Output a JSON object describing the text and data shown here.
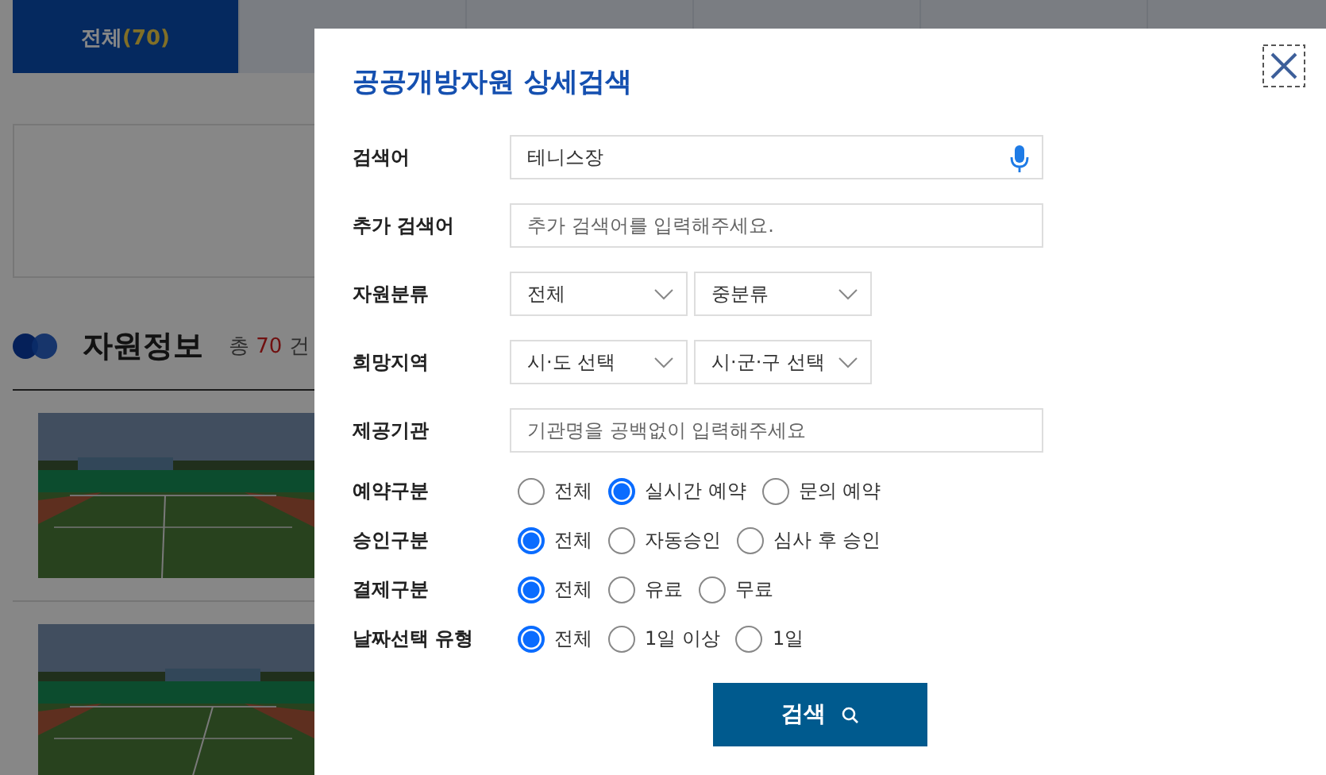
{
  "background_page": {
    "tabs": [
      {
        "label": "전체",
        "count": "(70)",
        "selected": true
      },
      {
        "selected": false
      },
      {
        "selected": false
      },
      {
        "selected": false
      },
      {
        "selected": false
      },
      {
        "selected": false
      }
    ],
    "section": {
      "title": "자원정보",
      "total_prefix": "총",
      "total_count": "70",
      "total_suffix": "건"
    }
  },
  "dialog": {
    "title": "공공개방자원 상세검색",
    "fields": [
      {
        "kind": "text",
        "label": "검색어",
        "value": "테니스장",
        "voice_input": true
      },
      {
        "kind": "text",
        "label": "추가 검색어",
        "placeholder": "추가 검색어를 입력해주세요.",
        "voice_input": false
      },
      {
        "kind": "selects",
        "label": "자원분류",
        "selects": [
          "전체",
          "중분류"
        ]
      },
      {
        "kind": "selects",
        "label": "희망지역",
        "selects": [
          "시·도 선택",
          "시·군·구 선택"
        ]
      },
      {
        "kind": "text",
        "label": "제공기관",
        "placeholder": "기관명을 공백없이 입력해주세요",
        "voice_input": false
      }
    ],
    "radio_groups": [
      {
        "label": "예약구분",
        "options": [
          {
            "label": "전체",
            "selected": false
          },
          {
            "label": "실시간 예약",
            "selected": true
          },
          {
            "label": "문의 예약",
            "selected": false
          }
        ]
      },
      {
        "label": "승인구분",
        "options": [
          {
            "label": "전체",
            "selected": true
          },
          {
            "label": "자동승인",
            "selected": false
          },
          {
            "label": "심사 후 승인",
            "selected": false
          }
        ]
      },
      {
        "label": "결제구분",
        "options": [
          {
            "label": "전체",
            "selected": true
          },
          {
            "label": "유료",
            "selected": false
          },
          {
            "label": "무료",
            "selected": false
          }
        ]
      },
      {
        "label": "날짜선택 유형",
        "options": [
          {
            "label": "전체",
            "selected": true
          },
          {
            "label": "1일 이상",
            "selected": false
          },
          {
            "label": "1일",
            "selected": false
          }
        ]
      }
    ],
    "submit": "검색"
  }
}
